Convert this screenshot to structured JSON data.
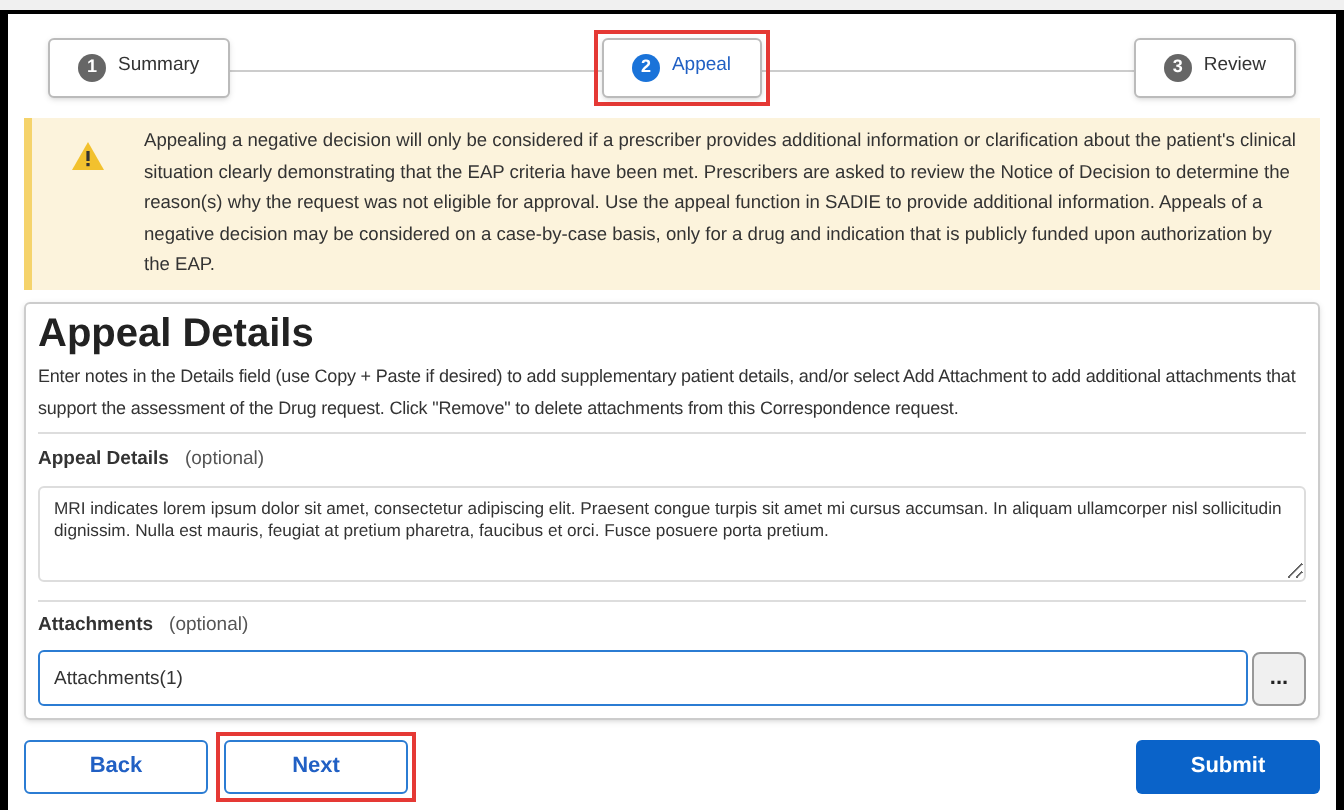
{
  "steps": [
    {
      "number": "1",
      "label": "Summary",
      "selected": false,
      "highlighted": false
    },
    {
      "number": "2",
      "label": "Appeal",
      "selected": true,
      "highlighted": true
    },
    {
      "number": "3",
      "label": "Review",
      "selected": false,
      "highlighted": false
    }
  ],
  "warning": "Appealing a negative decision will only be considered if a prescriber provides additional information or clarification about the patient's clinical situation clearly demonstrating that the EAP criteria have been met. Prescribers are asked to review the Notice of Decision to determine the reason(s) why the request was not eligible for approval. Use the appeal function in SADIE to provide additional information. Appeals of a negative decision may be considered on a case-by-case basis, only for a drug and indication that is publicly funded upon authorization by the EAP.",
  "section": {
    "title": "Appeal Details",
    "description": "Enter notes in the Details field (use Copy + Paste if desired) to add supplementary patient details, and/or select Add Attachment to add additional attachments that support the assessment of the Drug request. Click \"Remove\" to delete attachments from this Correspondence request.",
    "details": {
      "label": "Appeal Details",
      "hint": "(optional)",
      "value": "MRI indicates lorem ipsum dolor sit amet, consectetur adipiscing elit. Praesent congue turpis sit amet mi cursus accumsan. In aliquam ullamcorper nisl sollicitudin dignissim. Nulla est mauris, feugiat at pretium pharetra, faucibus et orci. Fusce posuere porta pretium."
    },
    "attachments": {
      "label": "Attachments",
      "hint": "(optional)",
      "value": "Attachments(1)",
      "button": "..."
    }
  },
  "buttons": [
    {
      "label": "Back",
      "kind": "outline",
      "highlighted": false
    },
    {
      "label": "Next",
      "kind": "outline",
      "highlighted": true
    },
    {
      "label": "Submit",
      "kind": "primary",
      "highlighted": false
    }
  ]
}
